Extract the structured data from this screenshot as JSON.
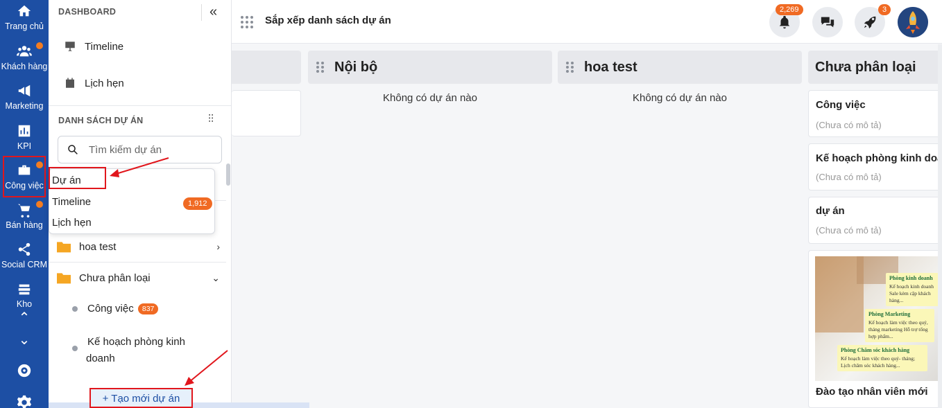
{
  "rail": {
    "items": [
      {
        "label": "Trang chủ",
        "icon": "home-icon"
      },
      {
        "label": "Khách hàng",
        "icon": "users-icon",
        "dot": true
      },
      {
        "label": "Marketing",
        "icon": "megaphone-icon"
      },
      {
        "label": "KPI",
        "icon": "bar-chart-icon"
      },
      {
        "label": "Công việc",
        "icon": "briefcase-icon",
        "dot": true,
        "active": true
      },
      {
        "label": "Bán hàng",
        "icon": "cart-icon",
        "dot": true
      },
      {
        "label": "Social CRM",
        "icon": "share-icon"
      },
      {
        "label": "Kho",
        "icon": "stack-icon"
      }
    ],
    "bottom_icons": [
      "chevron-up-icon",
      "chevron-down-icon",
      "lifebuoy-icon",
      "gear-icon"
    ],
    "colors": {
      "background": "#1d4fa4",
      "dot": "#f47c20",
      "highlight": "#e1161c"
    }
  },
  "sidebar": {
    "dashboard_heading": "DASHBOARD",
    "nav": [
      {
        "label": "Timeline",
        "icon": "presentation-icon"
      },
      {
        "label": "Lịch hẹn",
        "icon": "calendar-icon"
      }
    ],
    "projects_heading": "DANH SÁCH DỰ ÁN",
    "search_placeholder": "Tìm kiếm dự án",
    "folders": [
      {
        "label": "hoa test",
        "chevron": "›"
      },
      {
        "label": "Chưa phân loại",
        "chevron": "⌄"
      }
    ],
    "sub_items": [
      {
        "label": "Công việc",
        "count": "837"
      },
      {
        "label_line1": "Kế hoạch phòng kinh",
        "label_line2": "doanh"
      }
    ],
    "new_project_label": "+ Tạo mới dự án"
  },
  "popup": {
    "items": [
      "Dự án",
      "Timeline",
      "Lịch hẹn"
    ],
    "timeline_count": "1,912"
  },
  "header": {
    "title": "Sắp xếp danh sách dự án",
    "notifications_count": "2,269",
    "rocket_count": "3"
  },
  "board": {
    "columns": [
      {
        "title": "Nội bộ",
        "empty": "Không có dự án nào"
      },
      {
        "title": "hoa test",
        "empty": "Không có dự án nào"
      },
      {
        "title": "Chưa phân loại"
      }
    ],
    "cards": [
      {
        "title": "Công việc",
        "desc": "(Chưa có mô tả)"
      },
      {
        "title": "Kế hoạch phòng kinh doanh",
        "desc": "(Chưa có mô tả)"
      },
      {
        "title": "dự án",
        "desc": "(Chưa có mô tả)"
      }
    ],
    "image_card": {
      "title": "Đào tạo nhân viên mới",
      "notes": [
        {
          "head": "Phòng kinh doanh",
          "body": "Kế hoạch kinh doanh Sale kèm cặp khách hàng..."
        },
        {
          "head": "Phòng Marketing",
          "body": "Kế hoạch làm việc theo quý, tháng marketing Hỗ trợ tổng hợp phẩm..."
        },
        {
          "head": "Phòng Chăm sóc khách hàng",
          "body": "Kế hoạch làm việc theo quý- tháng; Lịch chăm sóc khách hàng..."
        }
      ]
    }
  }
}
